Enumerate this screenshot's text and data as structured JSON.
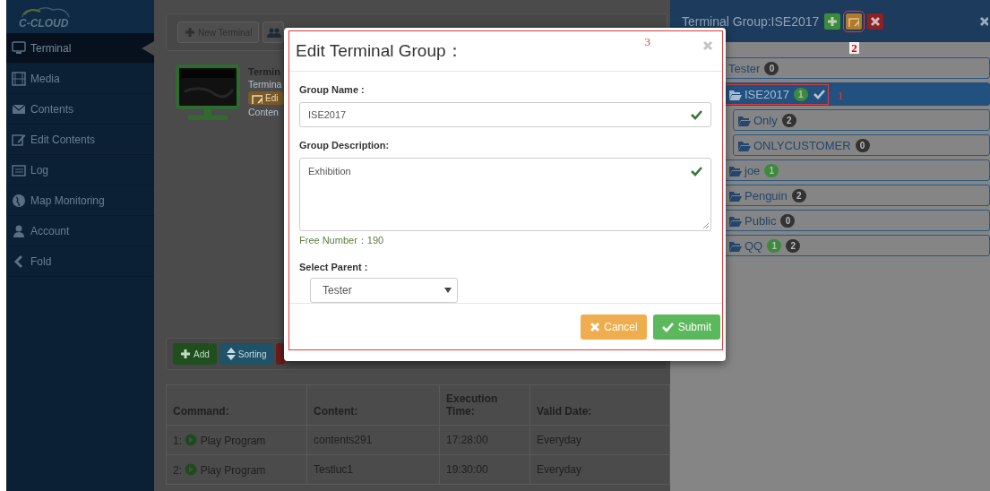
{
  "sidebar": {
    "logo": "C-CLOUD",
    "items": [
      {
        "label": "Terminal",
        "selected": true
      },
      {
        "label": "Media",
        "selected": false
      },
      {
        "label": "Contents",
        "selected": false
      },
      {
        "label": "Edit Contents",
        "selected": false
      },
      {
        "label": "Log",
        "selected": false
      },
      {
        "label": "Map Monitoring",
        "selected": false
      },
      {
        "label": "Account",
        "selected": false
      },
      {
        "label": "Fold",
        "selected": false
      }
    ]
  },
  "toolbar": {
    "new_terminal": "New Terminal"
  },
  "terminal_card": {
    "title": "Termin",
    "line": "Termina",
    "edit": "Edi",
    "content": "Conten"
  },
  "actions": {
    "add": "Add",
    "sorting": "Sorting"
  },
  "table": {
    "columns": [
      "Command:",
      "Content:",
      "Execution Time:",
      "Valid Date:"
    ],
    "rows": [
      {
        "index": "1:",
        "command": "Play Program",
        "content": "contents291",
        "time": "17:28:00",
        "date": "Everyday"
      },
      {
        "index": "2:",
        "command": "Play Program",
        "content": "Testluc1",
        "time": "19:30:00",
        "date": "Everyday"
      }
    ]
  },
  "group_panel": {
    "title": "Terminal Group:ISE2017",
    "edit_annotation": "2",
    "tree": [
      {
        "label": "Tester",
        "selected": false,
        "badges": [
          {
            "text": "0",
            "color": "#333333"
          }
        ],
        "children": [
          {
            "label": "ISE2017",
            "selected": true,
            "annotation": "1",
            "badges": [
              {
                "text": "1",
                "color": "#3c8a3c"
              }
            ],
            "children": [
              {
                "label": "Only",
                "selected": false,
                "badges": [
                  {
                    "text": "2",
                    "color": "#333333"
                  }
                ]
              },
              {
                "label": "ONLYCUSTOMER",
                "selected": false,
                "badges": [
                  {
                    "text": "0",
                    "color": "#333333"
                  }
                ]
              }
            ]
          },
          {
            "label": "joe",
            "selected": false,
            "badges": [
              {
                "text": "1",
                "color": "#3c8a3c"
              }
            ]
          },
          {
            "label": "Penguin",
            "selected": false,
            "badges": [
              {
                "text": "2",
                "color": "#333333"
              }
            ]
          },
          {
            "label": "Public",
            "selected": false,
            "badges": [
              {
                "text": "0",
                "color": "#333333"
              }
            ]
          },
          {
            "label": "QQ",
            "selected": false,
            "badges": [
              {
                "text": "1",
                "color": "#3c8a3c"
              },
              {
                "text": "2",
                "color": "#333333"
              }
            ]
          }
        ]
      }
    ]
  },
  "modal": {
    "title": "Edit Terminal Group：",
    "annotation": "3",
    "group_name_label": "Group Name :",
    "group_name": "ISE2017",
    "description_label": "Group Description:",
    "description": "Exhibition",
    "free_number": "Free Number：190",
    "parent_label": "Select Parent :",
    "parent": "Tester",
    "cancel": "Cancel",
    "submit": "Submit"
  }
}
